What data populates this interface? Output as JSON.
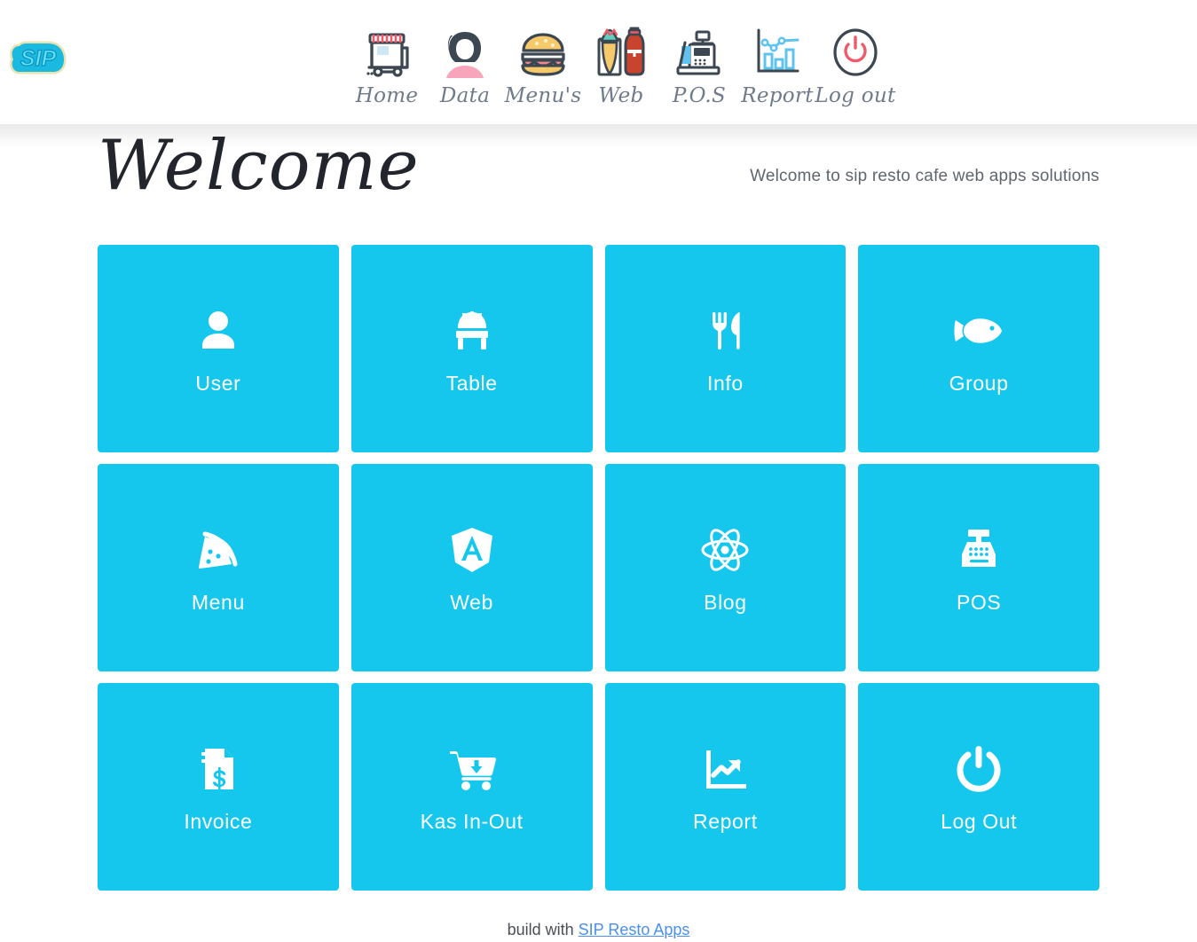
{
  "brand": {
    "logo_text": "SIP",
    "logo_fill": "#16c0e8",
    "logo_outline": "#e8e3b0"
  },
  "nav": {
    "items": [
      {
        "label": "Home",
        "icon": "food-truck-icon"
      },
      {
        "label": "Data",
        "icon": "person-avatar-icon"
      },
      {
        "label": "Menu's",
        "icon": "burger-icon"
      },
      {
        "label": "Web",
        "icon": "taco-soda-icon"
      },
      {
        "label": "P.O.S",
        "icon": "cash-register-icon"
      },
      {
        "label": "Report",
        "icon": "bar-chart-line-icon"
      },
      {
        "label": "Log out",
        "icon": "power-circle-icon"
      }
    ]
  },
  "welcome": {
    "title": "Welcome",
    "subtitle": "Welcome to sip resto cafe web apps solutions"
  },
  "tiles": [
    {
      "label": "User",
      "icon": "user-icon"
    },
    {
      "label": "Table",
      "icon": "chair-icon"
    },
    {
      "label": "Info",
      "icon": "fork-knife-icon"
    },
    {
      "label": "Group",
      "icon": "fish-icon"
    },
    {
      "label": "Menu",
      "icon": "pizza-slice-icon"
    },
    {
      "label": "Web",
      "icon": "angular-shield-icon"
    },
    {
      "label": "Blog",
      "icon": "react-atom-icon"
    },
    {
      "label": "POS",
      "icon": "cash-register-icon"
    },
    {
      "label": "Invoice",
      "icon": "invoice-dollar-icon"
    },
    {
      "label": "Kas In-Out",
      "icon": "cart-download-icon"
    },
    {
      "label": "Report",
      "icon": "chart-arrow-up-icon"
    },
    {
      "label": "Log Out",
      "icon": "power-icon"
    }
  ],
  "footer": {
    "prefix": "build with ",
    "link_label": "SIP Resto Apps"
  },
  "colors": {
    "tile": "#15c7ed",
    "nav_label": "#6f7a8a",
    "title": "#22262c",
    "link": "#4a90f0"
  }
}
